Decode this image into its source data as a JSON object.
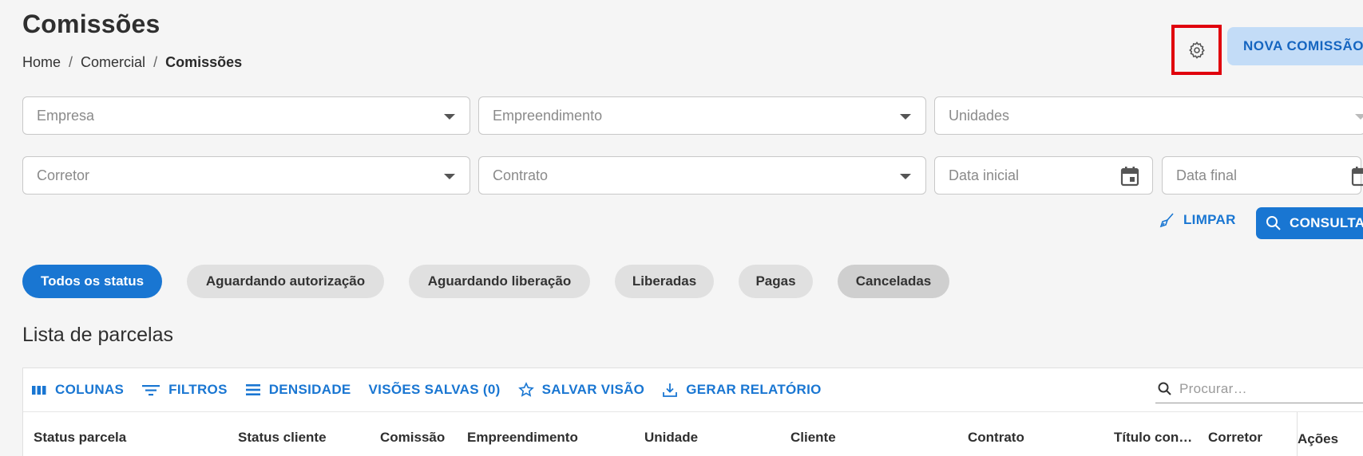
{
  "header": {
    "title": "Comissões",
    "breadcrumb": [
      "Home",
      "Comercial",
      "Comissões"
    ],
    "new_button": "NOVA COMISSÃO"
  },
  "filters": {
    "empresa": "Empresa",
    "empreendimento": "Empreendimento",
    "unidades": "Unidades",
    "corretor": "Corretor",
    "contrato": "Contrato",
    "data_inicial": "Data inicial",
    "data_final": "Data final",
    "clear_label": "LIMPAR",
    "consult_label": "CONSULTAR"
  },
  "status_chips": [
    {
      "label": "Todos os status"
    },
    {
      "label": "Aguardando autorização"
    },
    {
      "label": "Aguardando liberação"
    },
    {
      "label": "Liberadas"
    },
    {
      "label": "Pagas"
    },
    {
      "label": "Canceladas"
    }
  ],
  "list": {
    "title": "Lista de parcelas",
    "toolbar": {
      "columns": "COLUNAS",
      "filters": "FILTROS",
      "density": "DENSIDADE",
      "saved_views": "VISÕES SALVAS (0)",
      "save_view": "SALVAR VISÃO",
      "report": "GERAR RELATÓRIO",
      "search_placeholder": "Procurar…"
    },
    "columns": [
      "Status parcela",
      "Status cliente",
      "Comissão",
      "Empreendimento",
      "Unidade",
      "Cliente",
      "Contrato",
      "Título con…",
      "Corretor",
      "Ações"
    ]
  },
  "colors": {
    "primary": "#1976d2",
    "primary_light": "#c3dcf7",
    "highlight": "#e0000d"
  },
  "icons": [
    "gear-icon",
    "caret-down-icon",
    "calendar-icon",
    "broom-icon",
    "search-icon",
    "columns-icon",
    "filter-icon",
    "density-icon",
    "star-icon",
    "download-icon"
  ]
}
